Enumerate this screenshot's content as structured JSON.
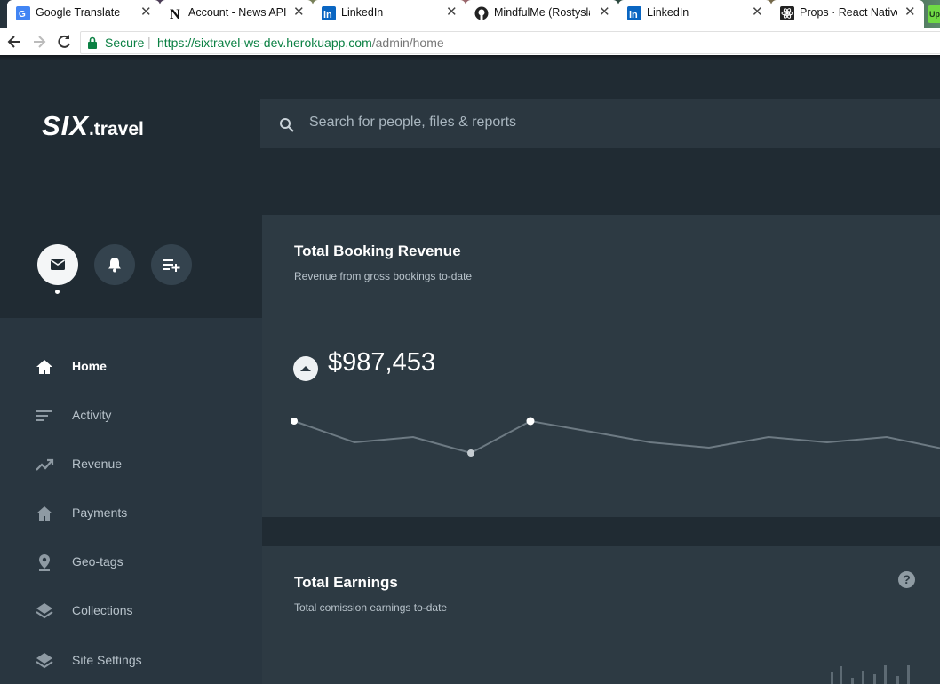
{
  "browser": {
    "tabs": [
      {
        "title": "Google Translate",
        "icon": "google-translate-icon"
      },
      {
        "title": "Account - News API",
        "icon": "newsapi-icon"
      },
      {
        "title": "LinkedIn",
        "icon": "linkedin-icon"
      },
      {
        "title": "MindfulMe (Rostysla",
        "icon": "github-icon"
      },
      {
        "title": "LinkedIn",
        "icon": "linkedin-icon"
      },
      {
        "title": "Props · React Native",
        "icon": "react-icon"
      }
    ],
    "secure_label": "Secure",
    "url_base": "https://sixtravel-ws-dev.herokuapp.com",
    "url_path": "/admin/home"
  },
  "app": {
    "logo_main": "SIX",
    "logo_suffix": ".travel",
    "search_placeholder": "Search for people, files & reports",
    "nav": [
      {
        "label": "Home",
        "icon": "home-icon",
        "active": true
      },
      {
        "label": "Activity",
        "icon": "activity-icon"
      },
      {
        "label": "Revenue",
        "icon": "trending-up-icon"
      },
      {
        "label": "Payments",
        "icon": "home-icon"
      },
      {
        "label": "Geo-tags",
        "icon": "location-pin-icon"
      },
      {
        "label": "Collections",
        "icon": "layers-icon"
      },
      {
        "label": "Site Settings",
        "icon": "layers-icon"
      }
    ],
    "cards": {
      "revenue": {
        "title": "Total Booking Revenue",
        "subtitle": "Revenue from gross bookings to-date",
        "value": "$987,453"
      },
      "earnings": {
        "title": "Total Earnings",
        "subtitle": "Total comission earnings to-date"
      }
    }
  },
  "colors": {
    "bg": "#202b33",
    "card": "#2d3a43",
    "sidebar_nav": "#293640",
    "secure_green": "#0b8043"
  }
}
